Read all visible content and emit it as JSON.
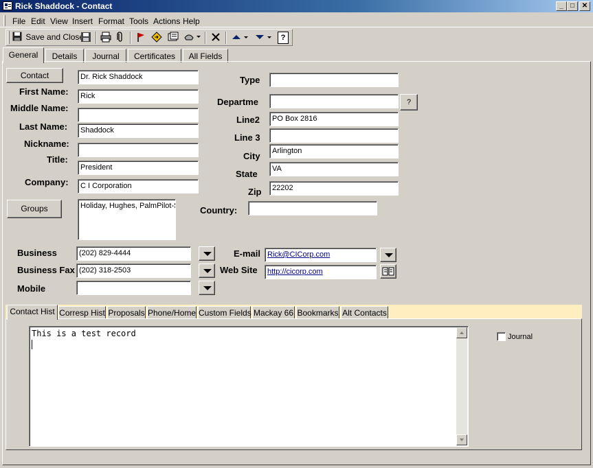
{
  "window": {
    "title": "Rick Shaddock - Contact",
    "min_glyph": "_",
    "max_glyph": "□",
    "close_glyph": "✕"
  },
  "menu": [
    "File",
    "Edit",
    "View",
    "Insert",
    "Format",
    "Tools",
    "Actions",
    "Help"
  ],
  "toolbar": {
    "save_close_label": "Save and Close",
    "help_glyph": "?"
  },
  "tabs": [
    "General",
    "Details",
    "Journal",
    "Certificates",
    "All Fields"
  ],
  "general": {
    "contact_button": "Contact",
    "full_name": "Dr. Rick Shaddock",
    "labels": {
      "first_name": "First Name:",
      "middle_name": "Middle Name:",
      "last_name": "Last Name:",
      "nickname": "Nickname:",
      "title": "Title:",
      "company": "Company:",
      "type": "Type",
      "department": "Departme",
      "line2": "Line2",
      "line3": "Line 3",
      "city": "City",
      "state": "State",
      "zip": "Zip",
      "country": "Country:",
      "business": "Business",
      "business_fax": "Business Fax",
      "mobile": "Mobile",
      "email": "E-mail",
      "website": "Web Site"
    },
    "first_name": "Rick",
    "middle_name": "",
    "last_name": "Shaddock",
    "nickname": "",
    "title": "President",
    "company": "C I Corporation",
    "groups_button": "Groups",
    "groups_value": "Holiday, Hughes, PalmPilot-S",
    "type": "",
    "department": "",
    "dept_help_button": "?",
    "line2": "PO Box 2816",
    "line3": "",
    "city": "Arlington",
    "state": "VA",
    "zip": "22202",
    "country": "",
    "business": "(202) 829-4444",
    "business_fax": "(202) 318-2503",
    "mobile": "",
    "email": "Rick@CICorp.com",
    "website": "http://cicorp.com"
  },
  "subtabs": [
    "Contact Hist",
    "Corresp Hist",
    "Proposals",
    "Phone/Home",
    "Custom Fields",
    "Mackay 66",
    "Bookmarks",
    "Alt Contacts"
  ],
  "contact_hist": {
    "notes": "This is a test record",
    "journal_label": "Journal",
    "journal_checked": false
  }
}
